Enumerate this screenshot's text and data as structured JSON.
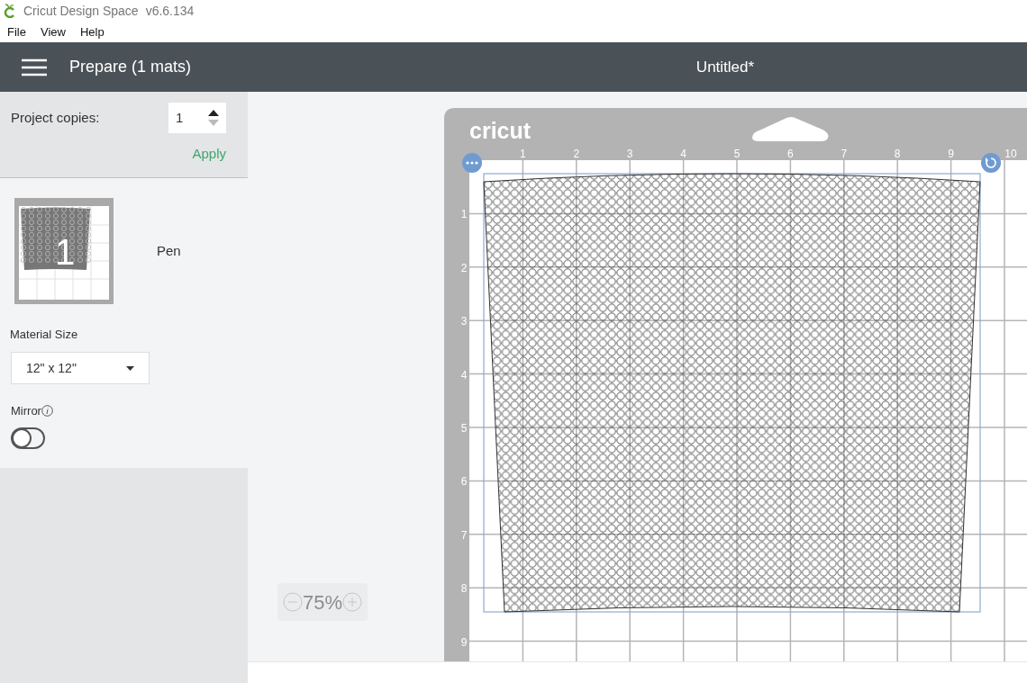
{
  "window": {
    "app_name": "Cricut Design Space",
    "version": "v6.6.134"
  },
  "menu": [
    "File",
    "View",
    "Help"
  ],
  "header": {
    "title": "Prepare (1 mats)",
    "document": "Untitled*"
  },
  "copies": {
    "label": "Project copies:",
    "value": "1",
    "decrement_disabled": true,
    "apply": "Apply"
  },
  "mats": [
    {
      "number": "1",
      "material": "Pen"
    }
  ],
  "material_size": {
    "label": "Material Size",
    "value": "12\" x 12\""
  },
  "mirror": {
    "label": "Mirror",
    "on": false
  },
  "zoom": {
    "value": "75%"
  },
  "mat": {
    "logo": "cricut",
    "top_ruler": [
      "1",
      "2",
      "3",
      "4",
      "5",
      "6",
      "7",
      "8",
      "9",
      "10"
    ],
    "side_ruler": [
      "1",
      "2",
      "3",
      "4",
      "5",
      "6",
      "7",
      "8",
      "9"
    ]
  }
}
